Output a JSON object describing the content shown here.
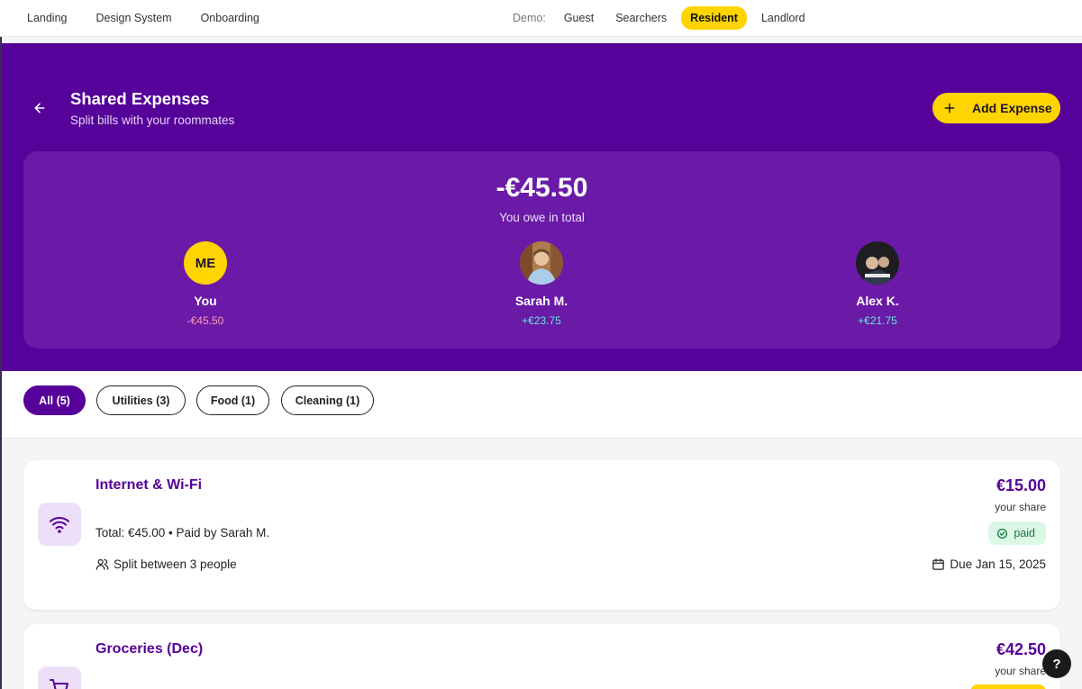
{
  "topnav": {
    "links": [
      "Landing",
      "Design System",
      "Onboarding"
    ],
    "demo_label": "Demo:",
    "demo_options": [
      "Guest",
      "Searchers",
      "Resident",
      "Landlord"
    ],
    "demo_active": "Resident"
  },
  "header": {
    "title": "Shared Expenses",
    "subtitle": "Split bills with your roommates",
    "add_button": "Add Expense"
  },
  "summary": {
    "total": "-€45.50",
    "total_label": "You owe in total",
    "members": [
      {
        "initials": "ME",
        "name": "You",
        "balance": "-€45.50",
        "status": "negative"
      },
      {
        "name": "Sarah M.",
        "balance": "+€23.75",
        "status": "positive"
      },
      {
        "name": "Alex K.",
        "balance": "+€21.75",
        "status": "positive"
      }
    ]
  },
  "filters": [
    "All (5)",
    "Utilities (3)",
    "Food (1)",
    "Cleaning (1)"
  ],
  "filter_active": "All (5)",
  "expenses": [
    {
      "icon": "wifi-icon",
      "name": "Internet & Wi-Fi",
      "meta": "Total: €45.00 • Paid by Sarah M.",
      "split": "Split between 3 people",
      "amount": "€15.00",
      "share_label": "your share",
      "status": "paid",
      "due": "Due Jan 15, 2025"
    },
    {
      "icon": "cart-icon",
      "name": "Groceries (Dec)",
      "amount": "€42.50",
      "share_label": "your share"
    }
  ],
  "help_label": "?",
  "colors": {
    "brand_purple": "#560199",
    "accent_yellow": "#ffd400"
  }
}
